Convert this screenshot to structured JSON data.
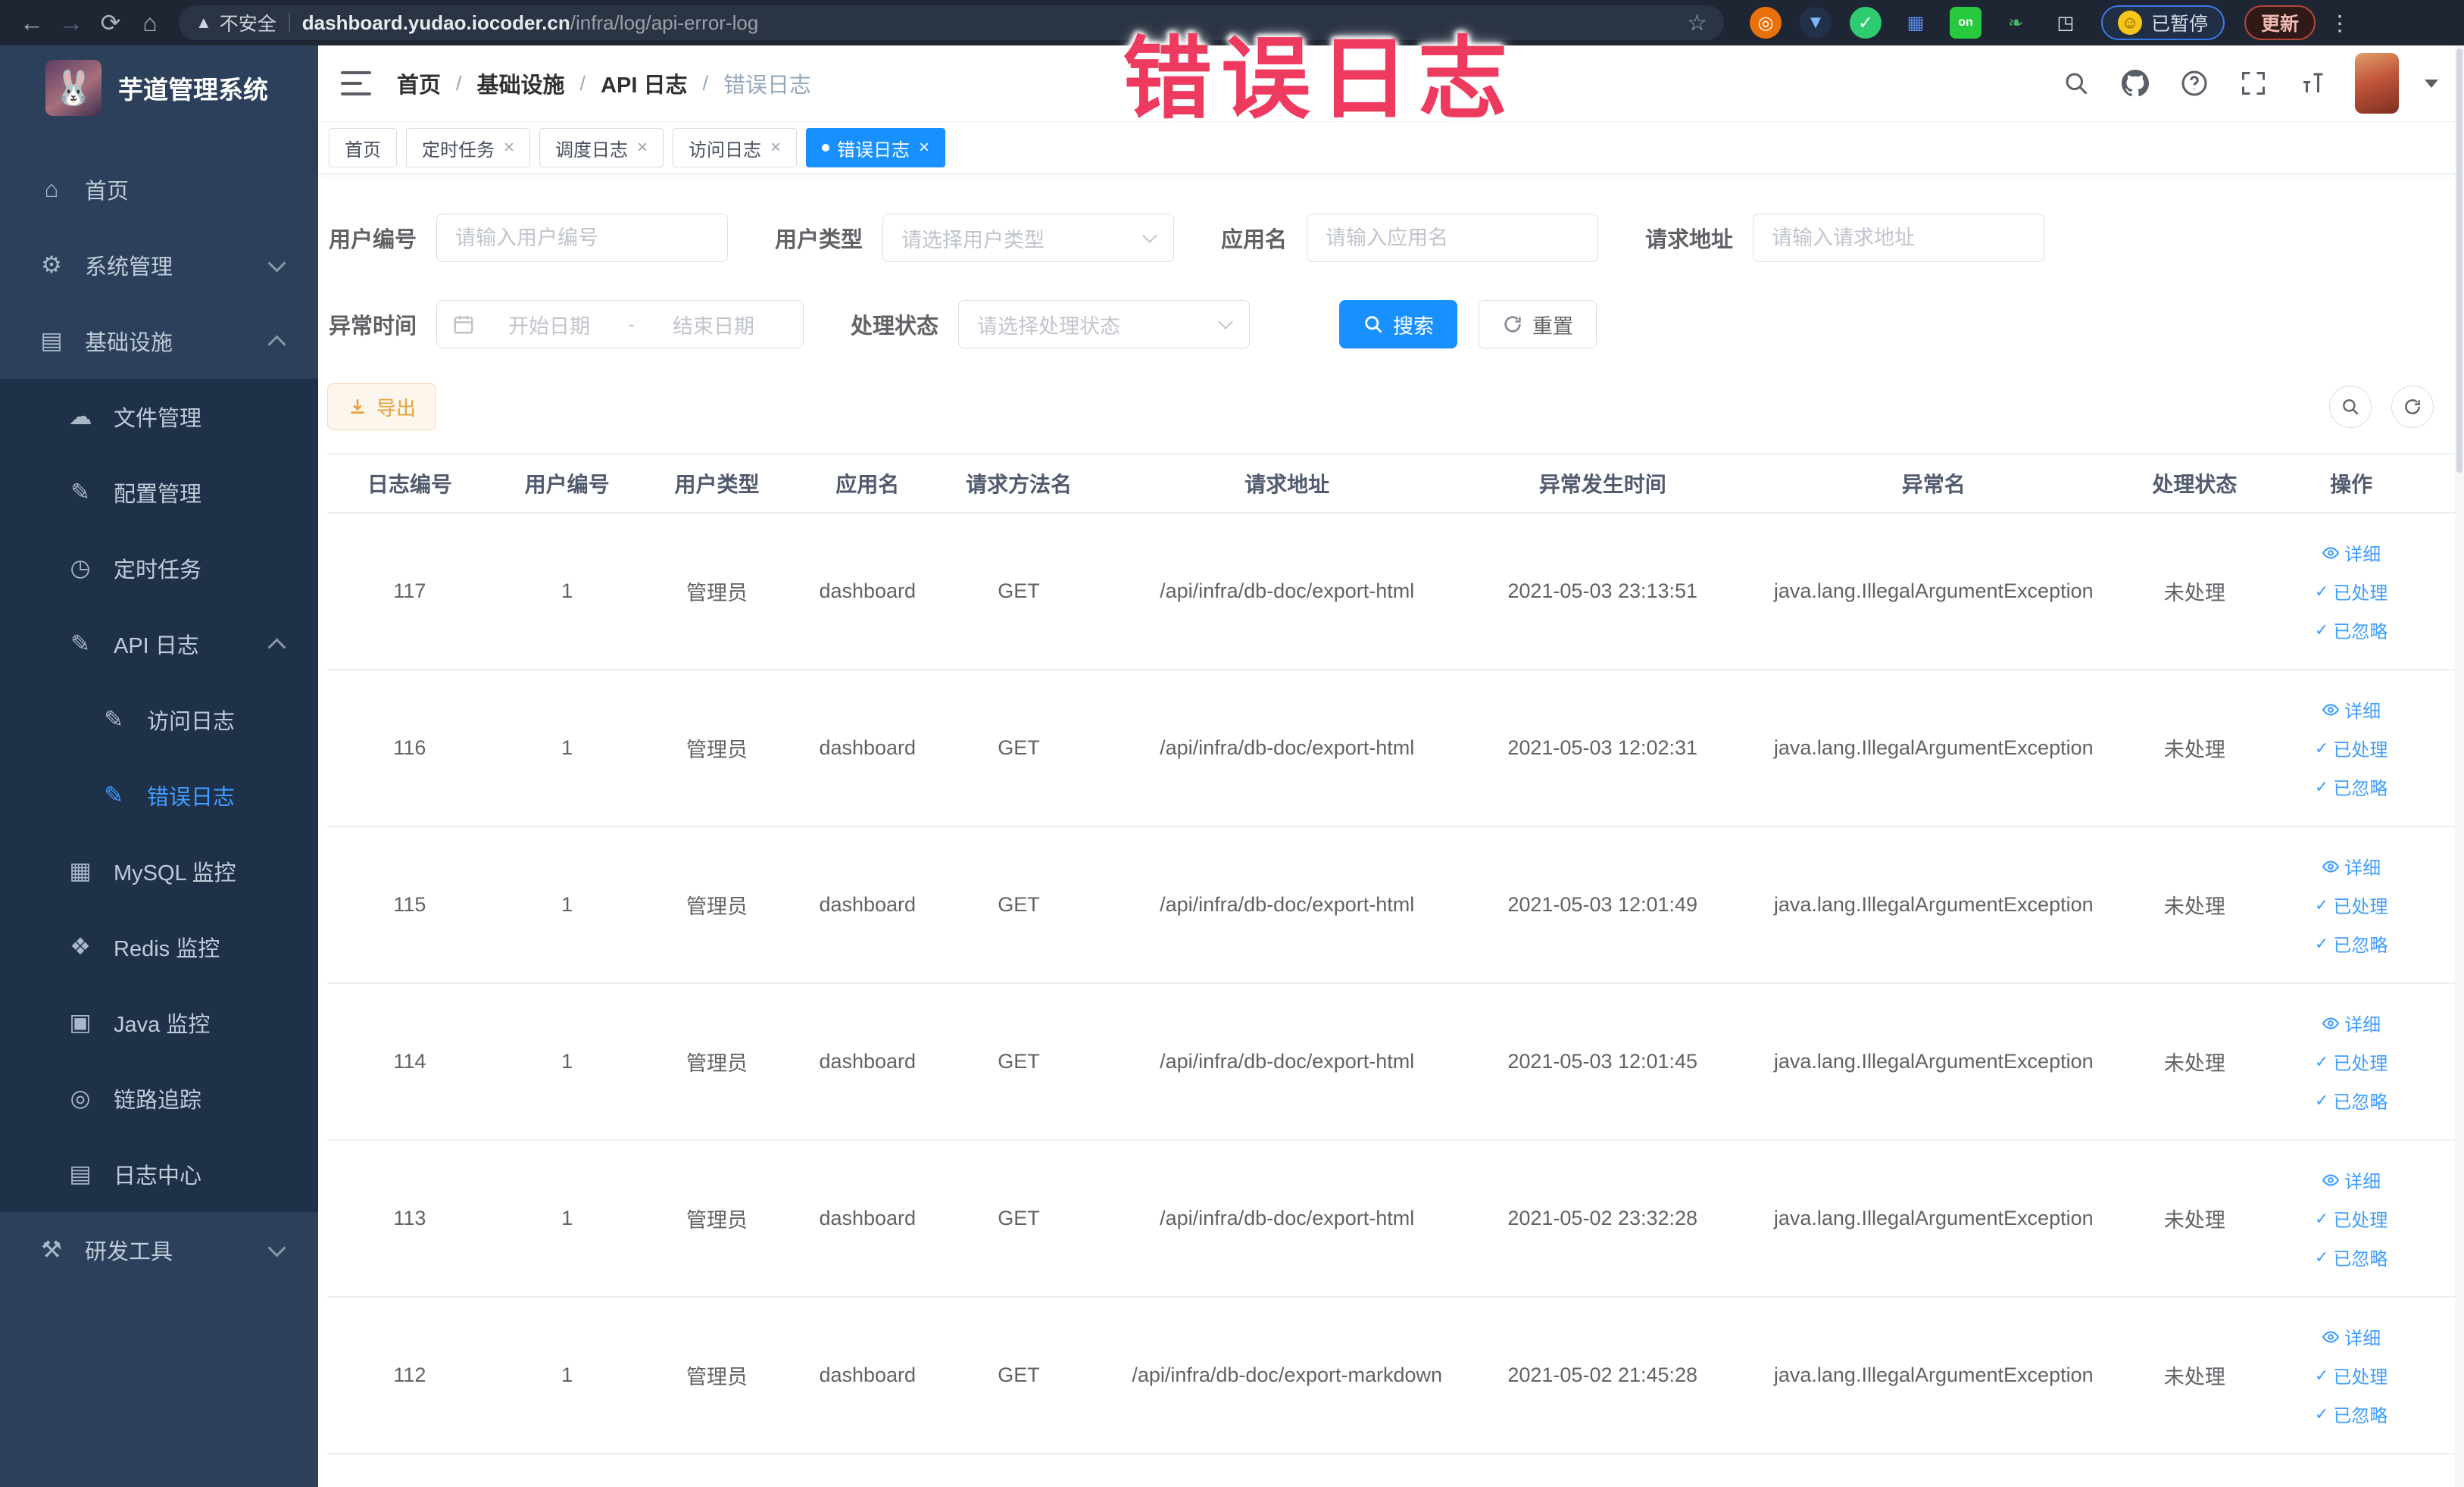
{
  "annotation": {
    "text": "错误日志",
    "color": "#ee3a5e"
  },
  "browser": {
    "security_label": "不安全",
    "url_host": "dashboard.yudao.iocoder.cn",
    "url_path": "/infra/log/api-error-log",
    "paused_label": "已暂停",
    "update_label": "更新",
    "extensions": [
      {
        "name": "extension-target-icon",
        "glyph": "◎",
        "bg": "#e8710a",
        "fg": "#ffffff",
        "shape": "circle"
      },
      {
        "name": "extension-shield-icon",
        "glyph": "▼",
        "bg": "#22304a",
        "fg": "#7ab8ff",
        "shape": "circle"
      },
      {
        "name": "extension-check-icon",
        "glyph": "✓",
        "bg": "#2ecc71",
        "fg": "#ffffff",
        "shape": "circle"
      },
      {
        "name": "extension-grid-icon",
        "glyph": "▦",
        "bg": "#1e2634",
        "fg": "#5b8def",
        "shape": "square"
      },
      {
        "name": "extension-switch-on-icon",
        "glyph": "on",
        "bg": "#27c93f",
        "fg": "#ffffff",
        "shape": "square"
      },
      {
        "name": "extension-leaf-icon",
        "glyph": "❧",
        "bg": "#1e2634",
        "fg": "#49b66a",
        "shape": "square"
      },
      {
        "name": "extension-puzzle-icon",
        "glyph": "◳",
        "bg": "#1e2634",
        "fg": "#e8eaed",
        "shape": "square"
      }
    ]
  },
  "sidebar": {
    "logo_title": "芋道管理系统",
    "logo_glyph": "🐰",
    "menu": [
      {
        "label": "首页",
        "icon": "home-icon",
        "glyph": "⌂",
        "level": 1
      },
      {
        "label": "系统管理",
        "icon": "gear-icon",
        "glyph": "⚙",
        "level": 1,
        "chevron": "down"
      },
      {
        "label": "基础设施",
        "icon": "monitor-icon",
        "glyph": "▤",
        "level": 1,
        "chevron": "up"
      },
      {
        "label": "文件管理",
        "icon": "cloud-icon",
        "glyph": "☁",
        "level": 2,
        "sub": true
      },
      {
        "label": "配置管理",
        "icon": "edit-icon",
        "glyph": "✎",
        "level": 2,
        "sub": true
      },
      {
        "label": "定时任务",
        "icon": "timer-icon",
        "glyph": "◷",
        "level": 2,
        "sub": true
      },
      {
        "label": "API 日志",
        "icon": "log-icon",
        "glyph": "✎",
        "level": 2,
        "sub": true,
        "chevron": "up"
      },
      {
        "label": "访问日志",
        "icon": "access-log-icon",
        "glyph": "✎",
        "level": 3,
        "sub": true
      },
      {
        "label": "错误日志",
        "icon": "error-log-icon",
        "glyph": "✎",
        "level": 3,
        "sub": true,
        "active": true
      },
      {
        "label": "MySQL 监控",
        "icon": "mysql-icon",
        "glyph": "▦",
        "level": 2,
        "sub": true
      },
      {
        "label": "Redis 监控",
        "icon": "redis-icon",
        "glyph": "❖",
        "level": 2,
        "sub": true
      },
      {
        "label": "Java 监控",
        "icon": "java-icon",
        "glyph": "▣",
        "level": 2,
        "sub": true
      },
      {
        "label": "链路追踪",
        "icon": "trace-eye-icon",
        "glyph": "◎",
        "level": 2,
        "sub": true
      },
      {
        "label": "日志中心",
        "icon": "log-center-icon",
        "glyph": "▤",
        "level": 2,
        "sub": true
      },
      {
        "label": "研发工具",
        "icon": "toolbox-icon",
        "glyph": "⚒",
        "level": 1,
        "chevron": "down"
      }
    ]
  },
  "navbar": {
    "breadcrumb": [
      "首页",
      "基础设施",
      "API 日志",
      "错误日志"
    ]
  },
  "tags": [
    {
      "label": "首页",
      "closable": false,
      "active": false
    },
    {
      "label": "定时任务",
      "closable": true,
      "active": false
    },
    {
      "label": "调度日志",
      "closable": true,
      "active": false
    },
    {
      "label": "访问日志",
      "closable": true,
      "active": false
    },
    {
      "label": "错误日志",
      "closable": true,
      "active": true
    }
  ],
  "filters": {
    "user_id": {
      "label": "用户编号",
      "placeholder": "请输入用户编号"
    },
    "user_type": {
      "label": "用户类型",
      "placeholder": "请选择用户类型"
    },
    "app_name": {
      "label": "应用名",
      "placeholder": "请输入应用名"
    },
    "request_url": {
      "label": "请求地址",
      "placeholder": "请输入请求地址"
    },
    "exception_time": {
      "label": "异常时间",
      "start_placeholder": "开始日期",
      "separator": "-",
      "end_placeholder": "结束日期"
    },
    "process_status": {
      "label": "处理状态",
      "placeholder": "请选择处理状态"
    },
    "search_label": "搜索",
    "reset_label": "重置"
  },
  "toolbar": {
    "export_label": "导出"
  },
  "table": {
    "columns": [
      "日志编号",
      "用户编号",
      "用户类型",
      "应用名",
      "请求方法名",
      "请求地址",
      "异常发生时间",
      "异常名",
      "处理状态",
      "操作"
    ],
    "action_labels": [
      "详细",
      "已处理",
      "已忽略"
    ],
    "rows": [
      {
        "id": "117",
        "user_id": "1",
        "user_type": "管理员",
        "app": "dashboard",
        "method": "GET",
        "url": "/api/infra/db-doc/export-html",
        "time": "2021-05-03 23:13:51",
        "exception": "java.lang.IllegalArgumentException",
        "status": "未处理"
      },
      {
        "id": "116",
        "user_id": "1",
        "user_type": "管理员",
        "app": "dashboard",
        "method": "GET",
        "url": "/api/infra/db-doc/export-html",
        "time": "2021-05-03 12:02:31",
        "exception": "java.lang.IllegalArgumentException",
        "status": "未处理"
      },
      {
        "id": "115",
        "user_id": "1",
        "user_type": "管理员",
        "app": "dashboard",
        "method": "GET",
        "url": "/api/infra/db-doc/export-html",
        "time": "2021-05-03 12:01:49",
        "exception": "java.lang.IllegalArgumentException",
        "status": "未处理"
      },
      {
        "id": "114",
        "user_id": "1",
        "user_type": "管理员",
        "app": "dashboard",
        "method": "GET",
        "url": "/api/infra/db-doc/export-html",
        "time": "2021-05-03 12:01:45",
        "exception": "java.lang.IllegalArgumentException",
        "status": "未处理"
      },
      {
        "id": "113",
        "user_id": "1",
        "user_type": "管理员",
        "app": "dashboard",
        "method": "GET",
        "url": "/api/infra/db-doc/export-html",
        "time": "2021-05-02 23:32:28",
        "exception": "java.lang.IllegalArgumentException",
        "status": "未处理"
      },
      {
        "id": "112",
        "user_id": "1",
        "user_type": "管理员",
        "app": "dashboard",
        "method": "GET",
        "url": "/api/infra/db-doc/export-markdown",
        "time": "2021-05-02 21:45:28",
        "exception": "java.lang.IllegalArgumentException",
        "status": "未处理"
      }
    ]
  },
  "colors": {
    "accent": "#1890ff",
    "link": "#409eff",
    "warning": "#e6a23c",
    "sidebar_bg": "#2c405c",
    "sidebar_sub_bg": "#1f3049",
    "annotation": "#ee3a5e"
  }
}
